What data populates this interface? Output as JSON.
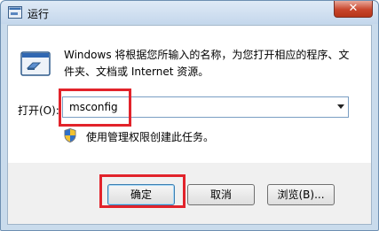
{
  "window": {
    "title": "运行",
    "close_symbol": "✕"
  },
  "dialog": {
    "description": "Windows 将根据您所输入的名称，为您打开相应的程序、文件夹、文档或 Internet 资源。",
    "open_label": "打开(O):",
    "command_value": "msconfig",
    "admin_note": "使用管理权限创建此任务。"
  },
  "buttons": {
    "ok": "确定",
    "cancel": "取消",
    "browse": "浏览(B)..."
  },
  "icons": {
    "app": "run-app-icon",
    "run": "run-program-icon",
    "shield": "uac-shield-icon",
    "close": "close-icon",
    "dropdown": "chevron-down-icon"
  },
  "colors": {
    "highlight": "#e2232b",
    "close_button": "#c8452b"
  }
}
